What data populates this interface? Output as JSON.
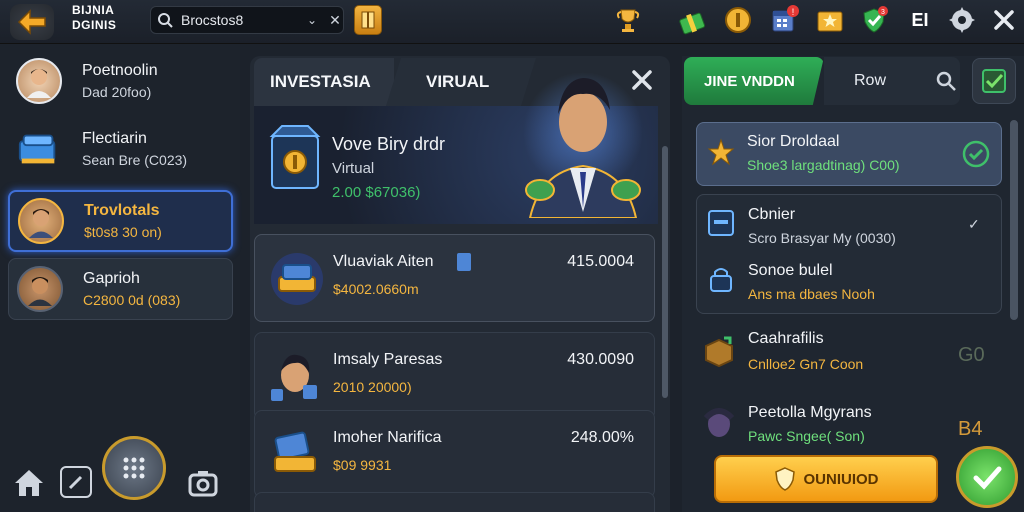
{
  "header": {
    "brand_line1": "BIJNIA",
    "brand_line2": "DGINIS",
    "search_value": "Brocstos8",
    "icons": [
      "back-arrow-icon",
      "gift-icon",
      "trophy-icon",
      "coin-icon",
      "calendar-icon",
      "star-folder-icon",
      "shield-icon",
      "text-icon",
      "gear-icon",
      "close-icon"
    ],
    "calendar_badge": "!",
    "shield_badge": "3",
    "text_icon_label": "EI"
  },
  "sidebar": {
    "items": [
      {
        "title": "Poetnoolin",
        "subtitle": "Dad 20foo)"
      },
      {
        "title": "Flectiarin",
        "subtitle": "Sean Bre (C023)"
      },
      {
        "title": "Trovlotals",
        "subtitle": "$t0s8 30 on)",
        "selected": true
      },
      {
        "title": "Gaprioh",
        "subtitle": "C2800 0d (083)"
      }
    ],
    "nav_icons": [
      "home-icon",
      "edit-icon",
      "grid-icon",
      "camera-icon"
    ]
  },
  "tabs": [
    {
      "label": "INVESTASIA"
    },
    {
      "label": "VIRUAL"
    }
  ],
  "hero": {
    "title": "Vove Biry drdr",
    "subtitle": "Virtual",
    "value": "2.00 $67036)"
  },
  "items": [
    {
      "name": "Vluaviak Aiten",
      "sub": "$4002.0660m",
      "value": "415.0004",
      "icon": "gold-bars-icon"
    },
    {
      "name": "Imsaly Paresas",
      "sub": "2010 20000)",
      "value": "430.0090",
      "icon": "avatar-icon"
    },
    {
      "name": "Imoher Narifica",
      "sub": "$09 9931",
      "value": "248.00%",
      "icon": "cash-stack-icon"
    }
  ],
  "right_tabs": [
    {
      "label": "JINE VNDDN"
    },
    {
      "label": "Row"
    }
  ],
  "right_list": [
    {
      "title": "Sior Droldaal",
      "sub": "Shoe3 largadtinag) C00)",
      "sub_color": "green",
      "selected": true,
      "trail": "check"
    },
    {
      "title": "Cbnier",
      "sub": "Scro Brasyar My (0030)",
      "sub_color": "white",
      "trail": "check-small"
    },
    {
      "title": "Sonoe bulel",
      "sub": "Ans ma dbaes Nooh",
      "sub_color": "gold",
      "trail": ""
    },
    {
      "title": "Caahrafilis",
      "sub": "Cnlloe2 Gn7 Coon",
      "sub_color": "gold",
      "trail": "G0"
    },
    {
      "title": "Peetolla Mgyrans",
      "sub": "Pawc Sngee( Son)",
      "sub_color": "green",
      "trail": "B4"
    }
  ],
  "action_button": "OUNIUIOD",
  "colors": {
    "accent_gold": "#f4b640",
    "accent_green": "#3fc06a",
    "panel_bg": "#232a34"
  }
}
